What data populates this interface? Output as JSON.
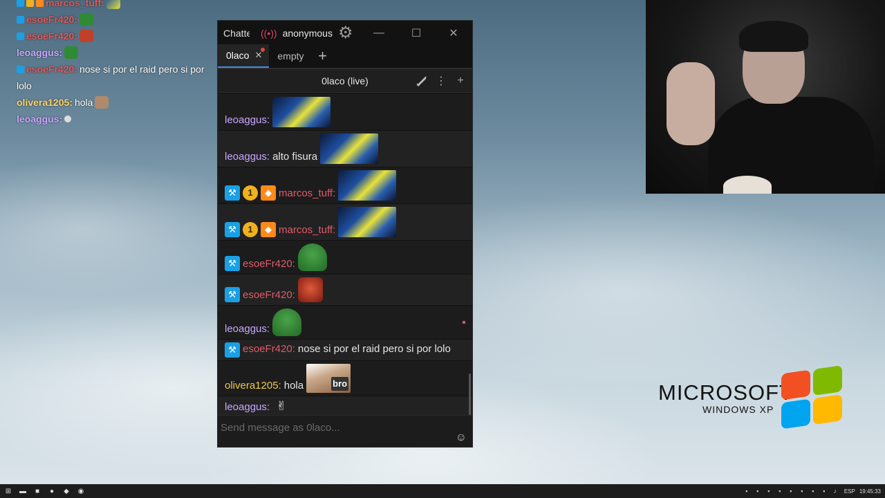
{
  "overlay_chat": [
    {
      "user": "marcos_tuff:",
      "message": "",
      "badges": [
        "mod",
        "sub",
        "gift"
      ],
      "emote": "sponge",
      "color": "#e05a5a"
    },
    {
      "user": "esoeFr420:",
      "message": "",
      "badges": [
        "mod"
      ],
      "emote": "pepe",
      "color": "#e05a5a"
    },
    {
      "user": "esoeFr420:",
      "message": "",
      "badges": [
        "mod"
      ],
      "emote": "angry",
      "color": "#e05a5a"
    },
    {
      "user": "leoaggus:",
      "message": "",
      "badges": [],
      "emote": "pepe",
      "color": "#c9a7ff"
    },
    {
      "user": "esoeFr420:",
      "message": "nose si por el raid pero si por",
      "message2": "lolo",
      "badges": [
        "mod"
      ],
      "emote": "",
      "color": "#e05a5a"
    },
    {
      "user": "olivera1205:",
      "message": "hola",
      "badges": [],
      "emote": "cat",
      "color": "#ffd66b"
    },
    {
      "user": "leoaggus:",
      "message": "",
      "badges": [],
      "emote": "hands",
      "color": "#c9a7ff"
    }
  ],
  "window": {
    "app_title": "Chatterino",
    "account": "anonymous",
    "live_icon": "broadcast-icon",
    "settings_icon": "gear-icon",
    "minimize": "—",
    "maximize": "☐",
    "close": "✕"
  },
  "tabs": [
    {
      "label": "0laco",
      "active": true,
      "close": "✕"
    },
    {
      "label": "empty",
      "active": false
    }
  ],
  "tab_add": "+",
  "split": {
    "title": "0laco (live)",
    "icons": [
      "sword-icon",
      "more-icon",
      "add-split-icon"
    ]
  },
  "messages": [
    {
      "user": "leoaggus:",
      "color": "purple",
      "text": "",
      "badges": [],
      "emote": "sponge"
    },
    {
      "user": "leoaggus:",
      "color": "purple",
      "text": "alto fisura",
      "badges": [],
      "emote": "sponge"
    },
    {
      "user": "marcos_tuff:",
      "color": "red",
      "text": "",
      "badges": [
        "mod",
        "sub",
        "gift"
      ],
      "emote": "sponge"
    },
    {
      "user": "marcos_tuff:",
      "color": "red",
      "text": "",
      "badges": [
        "mod",
        "sub",
        "gift"
      ],
      "emote": "sponge"
    },
    {
      "user": "esoeFr420:",
      "color": "red",
      "text": "",
      "badges": [
        "mod"
      ],
      "emote": "pepe"
    },
    {
      "user": "esoeFr420:",
      "color": "red",
      "text": "",
      "badges": [
        "mod"
      ],
      "emote": "angry"
    },
    {
      "user": "leoaggus:",
      "color": "purple",
      "text": "",
      "badges": [],
      "emote": "pepe"
    },
    {
      "user": "esoeFr420:",
      "color": "red",
      "text": "nose si por el raid pero si por lolo",
      "badges": [
        "mod"
      ],
      "emote": ""
    },
    {
      "user": "olivera1205:",
      "color": "gold",
      "text": "hola",
      "badges": [],
      "emote": "cat"
    },
    {
      "user": "leoaggus:",
      "color": "purple",
      "text": "",
      "badges": [],
      "emote": "hands"
    }
  ],
  "input": {
    "placeholder": "Send message as 0laco..."
  },
  "emoji_icon": "☺",
  "badge_text": {
    "mod": "⚒",
    "sub": "1",
    "gift": "◆"
  },
  "cat_emote_text": "bro",
  "xp_logo": {
    "line1": "MICROSOFT",
    "line2": "WINDOWS XP"
  },
  "taskbar": {
    "lang": "ESP",
    "time": "19:45:33"
  }
}
